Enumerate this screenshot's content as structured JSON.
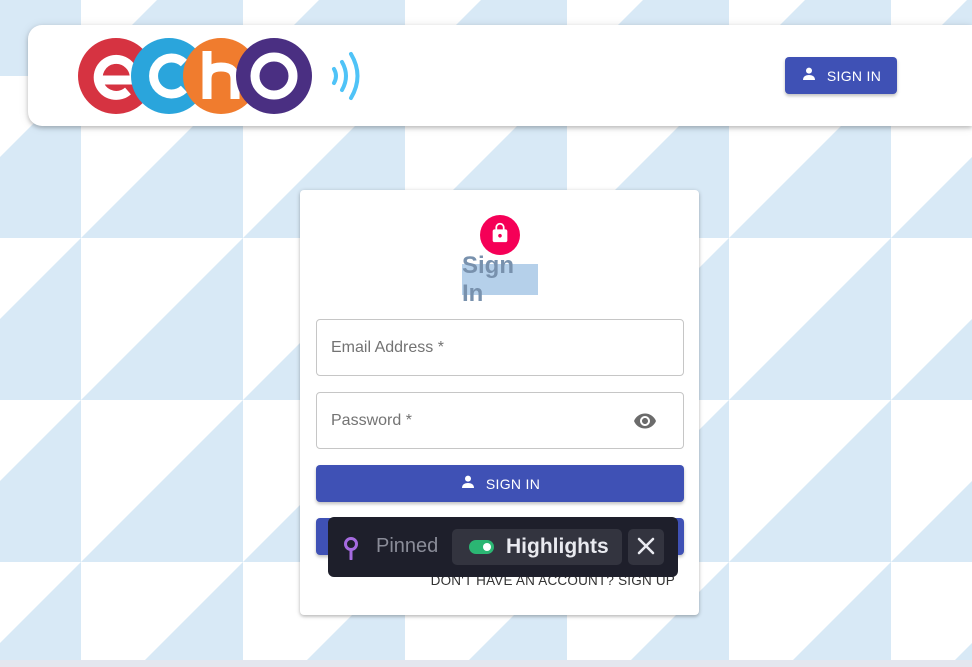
{
  "header": {
    "logo_text": "echo",
    "signin_label": "SIGN IN"
  },
  "login_card": {
    "title": "Sign In",
    "email": {
      "placeholder": "Email Address *",
      "value": ""
    },
    "password": {
      "placeholder": "Password *",
      "value": ""
    },
    "signin_label": "SIGN IN",
    "signup_link": "DON'T HAVE AN ACCOUNT? SIGN UP"
  },
  "overlay": {
    "pinned_label": "Pinned",
    "highlights_label": "Highlights",
    "highlights_enabled": true
  },
  "icons": {
    "header_button": "person-icon",
    "avatar": "lock-icon",
    "password_toggle": "eye-icon",
    "form_button": "person-icon",
    "overlay_pin": "pin-icon",
    "overlay_close": "close-icon"
  },
  "colors": {
    "primary": "#3f51b5",
    "avatar": "#f50057",
    "logo_e": "#d63341",
    "logo_c": "#2aa5dc",
    "logo_h": "#f07c2e",
    "logo_o": "#4a2f82",
    "logo_waves": "#4fc3f7",
    "pattern": "#d8e9f6",
    "overlay_bg": "#1e1f2b",
    "toggle_on": "#2bb673",
    "pin": "#a66be0"
  }
}
